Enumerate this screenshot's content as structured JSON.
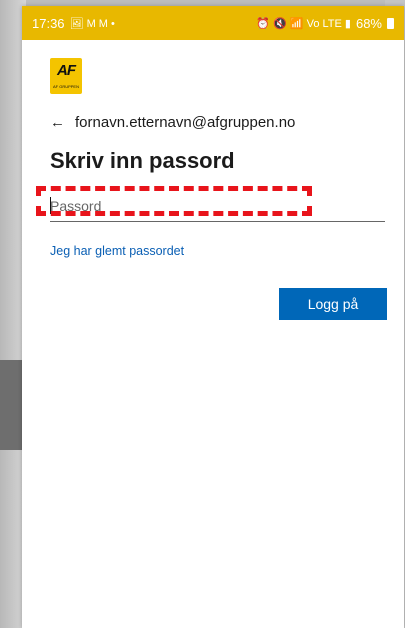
{
  "status_bar": {
    "time": "17:36",
    "left_icons": "🖼 M M •",
    "right_icons": "⏰ 🔇 📶 Vo LTE ▮",
    "battery": "68%"
  },
  "logo": {
    "text": "AF",
    "subtext": "AF GRUPPEN"
  },
  "identity": {
    "back_arrow": "←",
    "email": "fornavn.etternavn@afgruppen.no"
  },
  "page_title": "Skriv inn passord",
  "password_field": {
    "placeholder": "Passord",
    "value": ""
  },
  "forgot_link": "Jeg har glemt passordet",
  "signin_button": "Logg på",
  "colors": {
    "status_bar": "#e8b800",
    "accent": "#0067b8",
    "link": "#0a5fb4",
    "highlight": "#e8141b"
  }
}
